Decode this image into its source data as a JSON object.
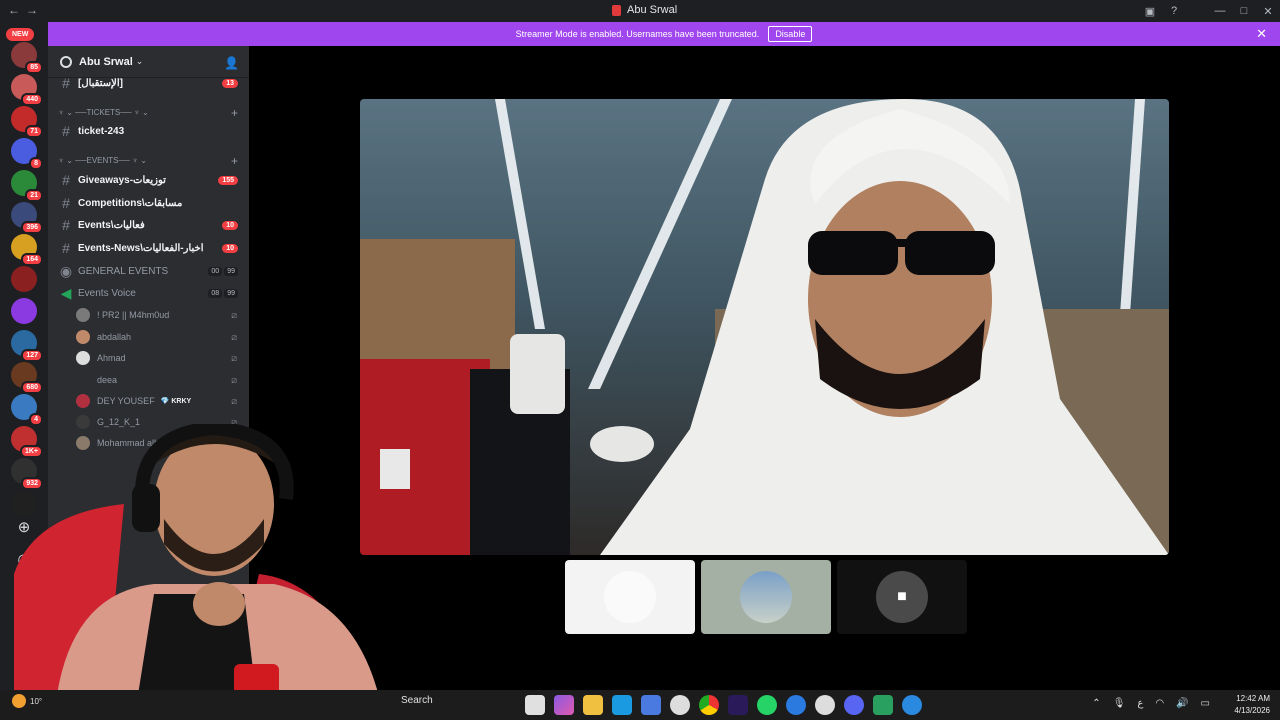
{
  "window": {
    "title": "Abu Srwal"
  },
  "banner": {
    "text": "Streamer Mode is enabled. Usernames have been truncated.",
    "disable_label": "Disable"
  },
  "server_rail": {
    "new_label": "NEW",
    "badges": [
      "85",
      "440",
      "71",
      "8",
      "21",
      "396",
      "164",
      "127",
      "680",
      "4",
      "1K+",
      "932"
    ]
  },
  "server": {
    "name": "Abu Srwal",
    "channels": [
      {
        "name": "[الإستقبال]",
        "badge": "13"
      },
      {
        "category": "TICKETS"
      },
      {
        "name": "ticket-243"
      },
      {
        "category": "EVENTS"
      },
      {
        "name": "Giveaways-توزيعات",
        "badge": "155"
      },
      {
        "name": "Competitions\\مسابقات"
      },
      {
        "name": "Events\\فعاليات",
        "badge": "10"
      },
      {
        "name": "Events-News\\أخبار-الفعاليات",
        "badge": "10"
      },
      {
        "name": "GENERAL EVENTS",
        "voice_a": "00",
        "voice_b": "99"
      },
      {
        "name": "Events Voice",
        "voice_a": "08",
        "voice_b": "99"
      }
    ],
    "voice_users": [
      {
        "name": "! PR2 || M4hm0ud"
      },
      {
        "name": "abdallah"
      },
      {
        "name": "Ahmad"
      },
      {
        "name": "deea"
      },
      {
        "name": "DEY YOUSEF",
        "tag": "KRKY"
      },
      {
        "name": "G_12_K_1"
      },
      {
        "name": "Mohammad alhade"
      }
    ]
  },
  "taskbar": {
    "search_label": "Search",
    "time": "12:42 AM",
    "date": "4/13/2026",
    "weather_temp": "10°"
  }
}
